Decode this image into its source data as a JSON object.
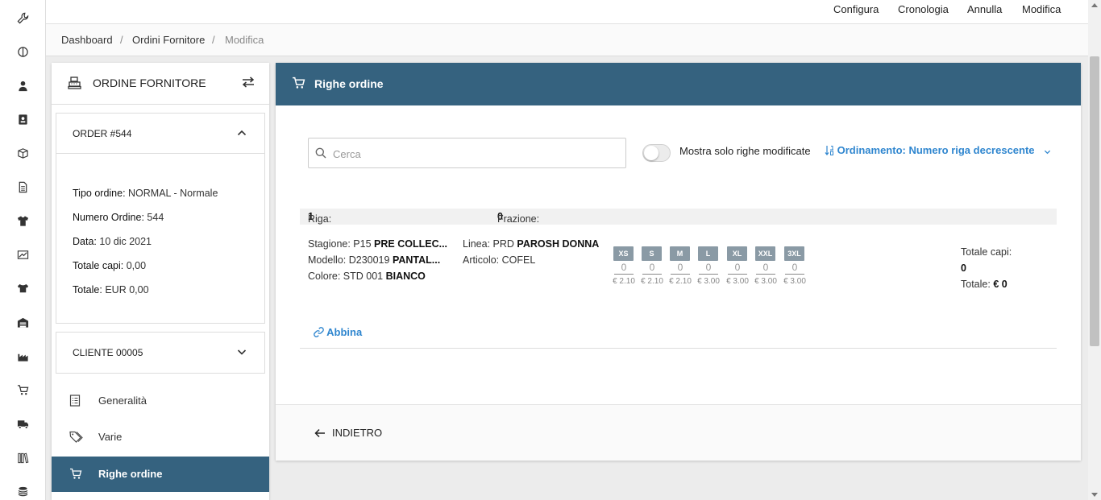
{
  "rail": {
    "icons": [
      "wrench-icon",
      "compass-icon",
      "user-tie-icon",
      "contact-card-icon",
      "box-icon",
      "document-icon",
      "tshirt-icon",
      "cash-register-icon",
      "shirt-box-icon",
      "warehouse-icon",
      "factory-icon",
      "cart-icon",
      "truck-icon",
      "books-icon",
      "coins-icon"
    ]
  },
  "topbar": {
    "configura": "Configura",
    "cronologia": "Cronologia",
    "annulla": "Annulla",
    "modifica": "Modifica"
  },
  "breadcrumb": {
    "items": [
      "Dashboard",
      "Ordini Fornitore",
      "Modifica"
    ],
    "separator": "/"
  },
  "left_panel": {
    "title": "ORDINE FORNITORE",
    "order_card": {
      "title": "ORDER #544",
      "tipo_label": "Tipo ordine:",
      "tipo_value": "NORMAL - Normale",
      "numero_label": "Numero Ordine:",
      "numero_value": "544",
      "data_label": "Data:",
      "data_value": "10 dic 2021",
      "capi_label": "Totale capi:",
      "capi_value": "0,00",
      "totale_label": "Totale:",
      "totale_value": "EUR 0,00"
    },
    "client_card": {
      "title": "CLIENTE 00005"
    },
    "nav": [
      {
        "label": "Generalità",
        "icon": "list-document-icon",
        "active": false
      },
      {
        "label": "Varie",
        "icon": "tags-icon",
        "active": false
      },
      {
        "label": "Righe ordine",
        "icon": "cart-icon",
        "active": true
      }
    ]
  },
  "main": {
    "title": "Righe ordine",
    "search_placeholder": "Cerca",
    "toggle_label": "Mostra solo righe modificate",
    "toggle_on": false,
    "sort_label": "Ordinamento: Numero riga decrescente",
    "row": {
      "riga_label": "Riga:",
      "riga_value": "1",
      "frazione_label": "Frazione:",
      "frazione_value": "0",
      "stagione_label": "Stagione: P15",
      "stagione_value": "PRE COLLEC...",
      "modello_label": "Modello: D230019",
      "modello_value": "PANTAL...",
      "colore_label": "Colore: STD 001",
      "colore_value": "BIANCO",
      "linea_label": "Linea: PRD",
      "linea_value": "PAROSH DONNA",
      "articolo_label": "Articolo: COFEL",
      "sizes": [
        {
          "size": "XS",
          "qty": "0",
          "price": "€ 2.10"
        },
        {
          "size": "S",
          "qty": "0",
          "price": "€ 2.10"
        },
        {
          "size": "M",
          "qty": "0",
          "price": "€ 2.10"
        },
        {
          "size": "L",
          "qty": "0",
          "price": "€ 3.00"
        },
        {
          "size": "XL",
          "qty": "0",
          "price": "€ 3.00"
        },
        {
          "size": "XXL",
          "qty": "0",
          "price": "€ 3.00"
        },
        {
          "size": "3XL",
          "qty": "0",
          "price": "€ 3.00"
        }
      ],
      "totale_capi_label": "Totale capi:",
      "totale_capi_value": "0",
      "totale_label": "Totale:",
      "totale_value": "€ 0"
    },
    "abbina_label": "Abbina",
    "back_label": "INDIETRO"
  }
}
